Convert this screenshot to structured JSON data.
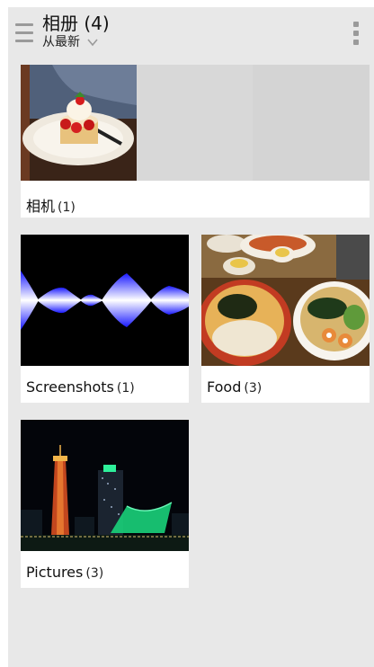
{
  "app": {
    "title": "相册 (4)",
    "subtitle": "从最新"
  },
  "albums": [
    {
      "name": "相机",
      "count": "(1)"
    },
    {
      "name": "Screenshots",
      "count": "(1)"
    },
    {
      "name": "Food",
      "count": "(3)"
    },
    {
      "name": "Pictures",
      "count": "(3)"
    }
  ],
  "icons": {
    "menu": "menu-icon",
    "dropdown": "chevron-down-icon",
    "overflow": "overflow-menu-icon"
  },
  "colors": {
    "background": "#e8e8e8",
    "card": "#ffffff",
    "icon": "#9a9a9a"
  }
}
